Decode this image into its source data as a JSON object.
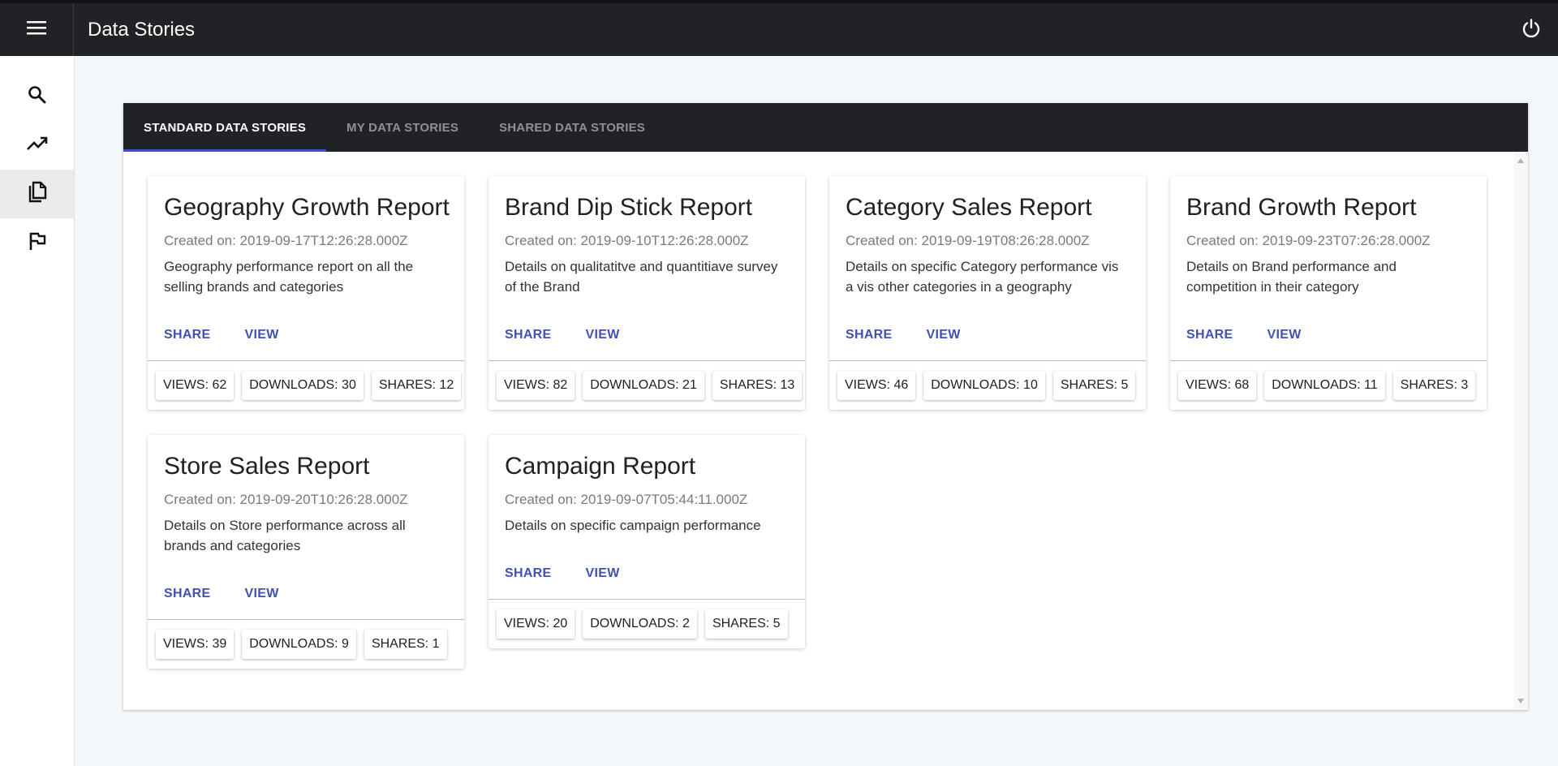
{
  "app": {
    "title": "Data Stories",
    "menu_icon": "menu-icon",
    "power_icon": "power-icon"
  },
  "sidebar": {
    "items": [
      {
        "icon": "search-icon",
        "active": false
      },
      {
        "icon": "trending-up-icon",
        "active": false
      },
      {
        "icon": "copy-icon",
        "active": true
      },
      {
        "icon": "flag-icon",
        "active": false
      }
    ]
  },
  "tabs": [
    {
      "label": "STANDARD DATA STORIES",
      "active": true
    },
    {
      "label": "MY DATA STORIES",
      "active": false
    },
    {
      "label": "SHARED DATA STORIES",
      "active": false
    }
  ],
  "cards": [
    {
      "title": "Geography Growth Report",
      "created": "Created on: 2019-09-17T12:26:28.000Z",
      "description": "Geography performance report on all the selling brands and categories",
      "share_label": "SHARE",
      "view_label": "VIEW",
      "views": "VIEWS: 62",
      "downloads": "DOWNLOADS: 30",
      "shares": "SHARES: 12"
    },
    {
      "title": "Brand Dip Stick Report",
      "created": "Created on: 2019-09-10T12:26:28.000Z",
      "description": "Details on qualitatitve and quantitiave survey of the Brand",
      "share_label": "SHARE",
      "view_label": "VIEW",
      "views": "VIEWS: 82",
      "downloads": "DOWNLOADS: 21",
      "shares": "SHARES: 13"
    },
    {
      "title": "Category Sales Report",
      "created": "Created on: 2019-09-19T08:26:28.000Z",
      "description": "Details on specific Category performance vis a vis other categories in a geography",
      "share_label": "SHARE",
      "view_label": "VIEW",
      "views": "VIEWS: 46",
      "downloads": "DOWNLOADS: 10",
      "shares": "SHARES: 5"
    },
    {
      "title": "Brand Growth Report",
      "created": "Created on: 2019-09-23T07:26:28.000Z",
      "description": "Details on Brand performance and competition in their category",
      "share_label": "SHARE",
      "view_label": "VIEW",
      "views": "VIEWS: 68",
      "downloads": "DOWNLOADS: 11",
      "shares": "SHARES: 3"
    },
    {
      "title": "Store Sales Report",
      "created": "Created on: 2019-09-20T10:26:28.000Z",
      "description": "Details on Store performance across all brands and categories",
      "share_label": "SHARE",
      "view_label": "VIEW",
      "views": "VIEWS: 39",
      "downloads": "DOWNLOADS: 9",
      "shares": "SHARES: 1"
    },
    {
      "title": "Campaign Report",
      "created": "Created on: 2019-09-07T05:44:11.000Z",
      "description": "Details on specific campaign performance",
      "share_label": "SHARE",
      "view_label": "VIEW",
      "views": "VIEWS: 20",
      "downloads": "DOWNLOADS: 2",
      "shares": "SHARES: 5"
    }
  ],
  "colors": {
    "appbar": "#212225",
    "accent": "#3f51b5",
    "background": "#f4f7fa"
  }
}
